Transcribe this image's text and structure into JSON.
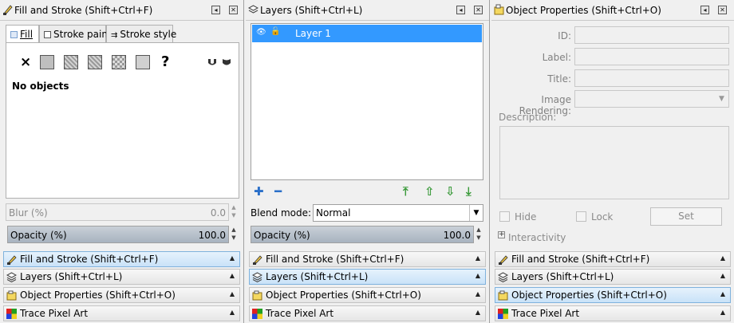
{
  "fill_stroke": {
    "title": "Fill and Stroke (Shift+Ctrl+F)",
    "tabs": [
      {
        "label": "Fill",
        "icon": "fill-tab-icon"
      },
      {
        "label": "Stroke paint",
        "icon": "stroke-paint-tab-icon"
      },
      {
        "label": "Stroke style",
        "icon": "stroke-style-tab-icon"
      }
    ],
    "fill_buttons": [
      "no-paint",
      "flat-color",
      "linear-gradient",
      "radial-gradient",
      "pattern",
      "swatch",
      "unset"
    ],
    "unset_glyph": "?",
    "no_objects_text": "No objects",
    "blur_label": "Blur (%)",
    "blur_value": "0.0",
    "opacity_label": "Opacity (%)",
    "opacity_value": "100.0"
  },
  "layers": {
    "title": "Layers (Shift+Ctrl+L)",
    "items": [
      {
        "name": "Layer 1",
        "visible": true,
        "locked": false
      }
    ],
    "blend_mode_label": "Blend mode:",
    "blend_mode_value": "Normal",
    "opacity_label": "Opacity (%)",
    "opacity_value": "100.0"
  },
  "object_props": {
    "title": "Object Properties (Shift+Ctrl+O)",
    "id_label": "ID:",
    "label_label": "Label:",
    "title_label": "Title:",
    "image_rendering_label": "Image Rendering:",
    "description_label": "Description:",
    "hide_label": "Hide",
    "lock_label": "Lock",
    "set_label": "Set",
    "interactivity_label": "Interactivity",
    "expander": "+"
  },
  "dock_items": [
    "Fill and Stroke (Shift+Ctrl+F)",
    "Layers (Shift+Ctrl+L)",
    "Object Properties (Shift+Ctrl+O)",
    "Trace Pixel Art"
  ],
  "colors": {
    "selection": "#3399ff",
    "accent_green": "#3a9a3a",
    "accent_blue": "#2a6fc9",
    "active_dock_bg": "#c9e2f8"
  }
}
